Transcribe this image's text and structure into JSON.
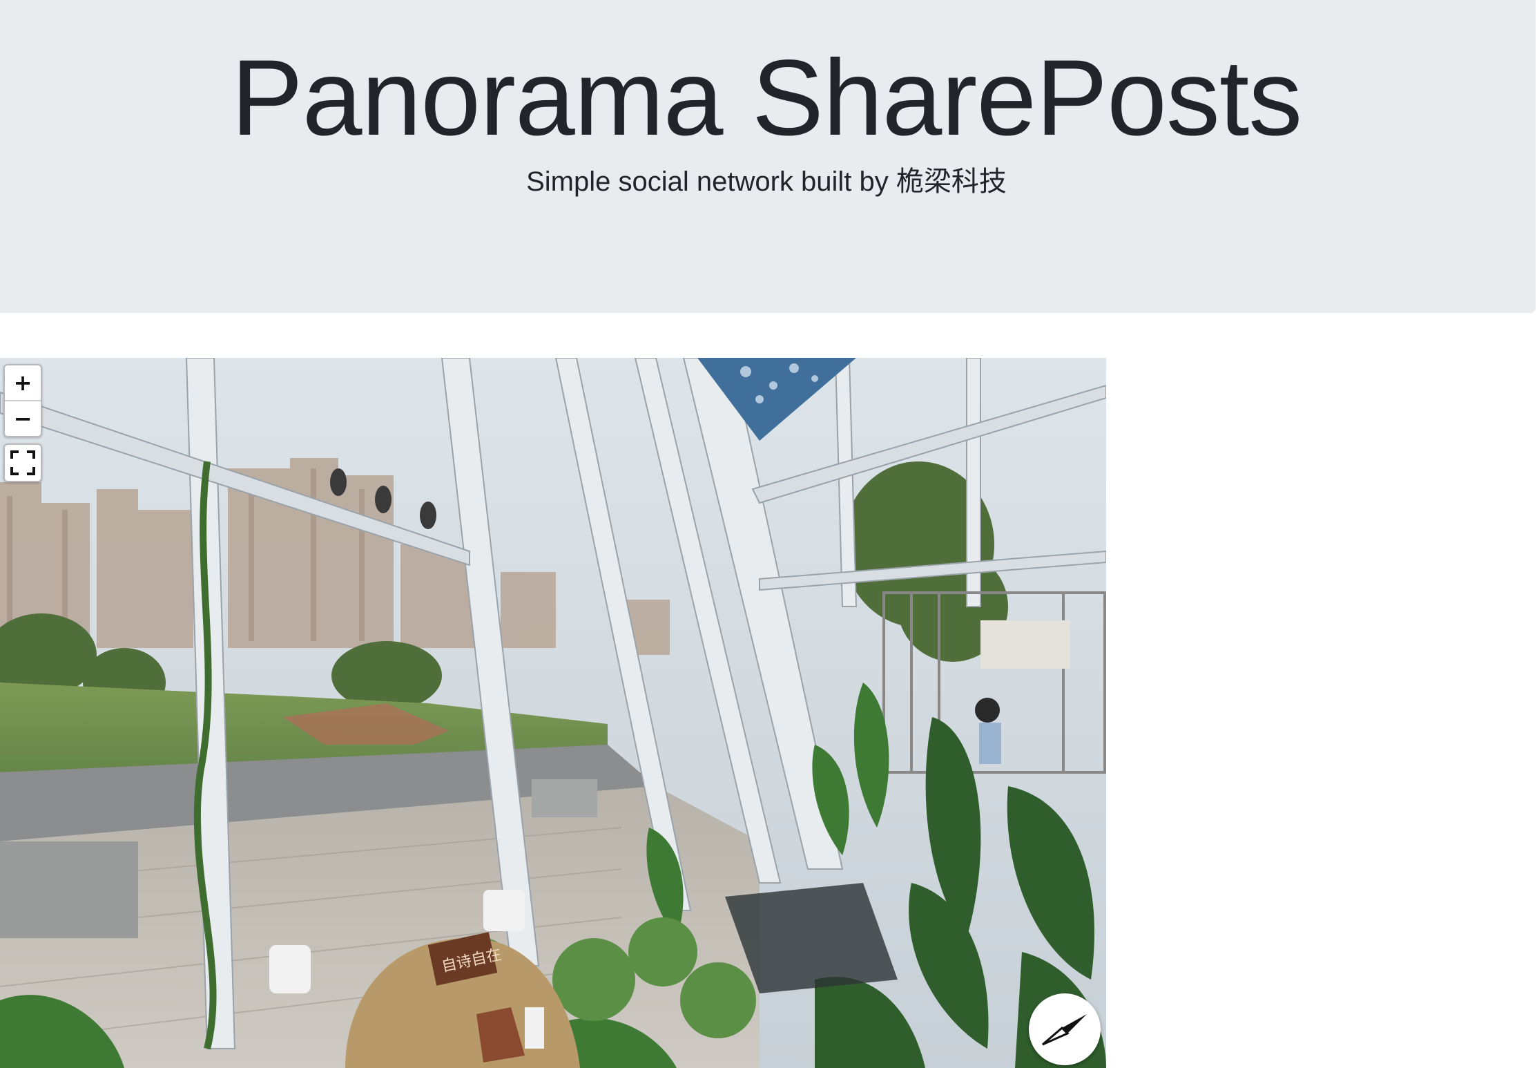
{
  "header": {
    "title": "Panorama SharePosts",
    "subtitle": "Simple social network built by 桅梁科技"
  },
  "viewer": {
    "zoom_in_label": "+",
    "zoom_out_label": "−",
    "fullscreen_icon": "fullscreen-icon",
    "compass_icon": "compass-icon",
    "panorama_sign_text": "自诗自在"
  }
}
